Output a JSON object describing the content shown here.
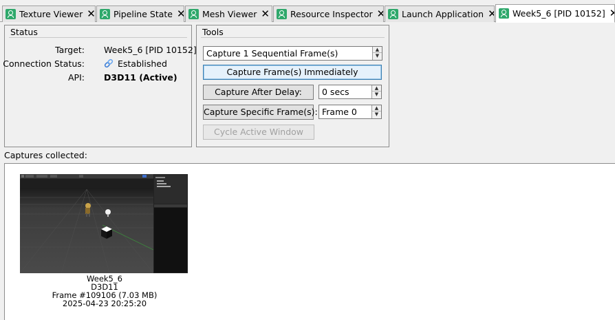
{
  "tabs": [
    {
      "label": "Texture Viewer",
      "close": "✕",
      "active": false
    },
    {
      "label": "Pipeline State",
      "close": "✕",
      "active": false
    },
    {
      "label": "Mesh Viewer",
      "close": "✕",
      "active": false
    },
    {
      "label": "Resource Inspector",
      "close": "✕",
      "active": false
    },
    {
      "label": "Launch Application",
      "close": "✕",
      "active": false
    },
    {
      "label": "Week5_6 [PID 10152]",
      "close": "✕",
      "active": true
    }
  ],
  "status": {
    "title": "Status",
    "target_label": "Target:",
    "target_value": "Week5_6 [PID 10152]",
    "connection_label": "Connection Status:",
    "connection_value": "Established",
    "api_label": "API:",
    "api_value": "D3D11 (Active)"
  },
  "tools": {
    "title": "Tools",
    "capture_count": "Capture 1 Sequential Frame(s)",
    "capture_now": "Capture Frame(s) Immediately",
    "capture_after_delay": "Capture After Delay:",
    "delay_value": "0 secs",
    "capture_specific": "Capture Specific Frame(s):",
    "frame_value": "Frame 0",
    "cycle_window": "Cycle Active Window"
  },
  "captures": {
    "label": "Captures collected:",
    "items": [
      {
        "name": "Week5_6",
        "api": "D3D11",
        "frame": "Frame #109106 (7.03 MB)",
        "timestamp": "2025-04-23 20:25:20"
      }
    ]
  },
  "colors": {
    "tab_icon": "#2ea86b",
    "focus_border": "#3c7fb1",
    "window_bg": "#f0f0f0"
  }
}
